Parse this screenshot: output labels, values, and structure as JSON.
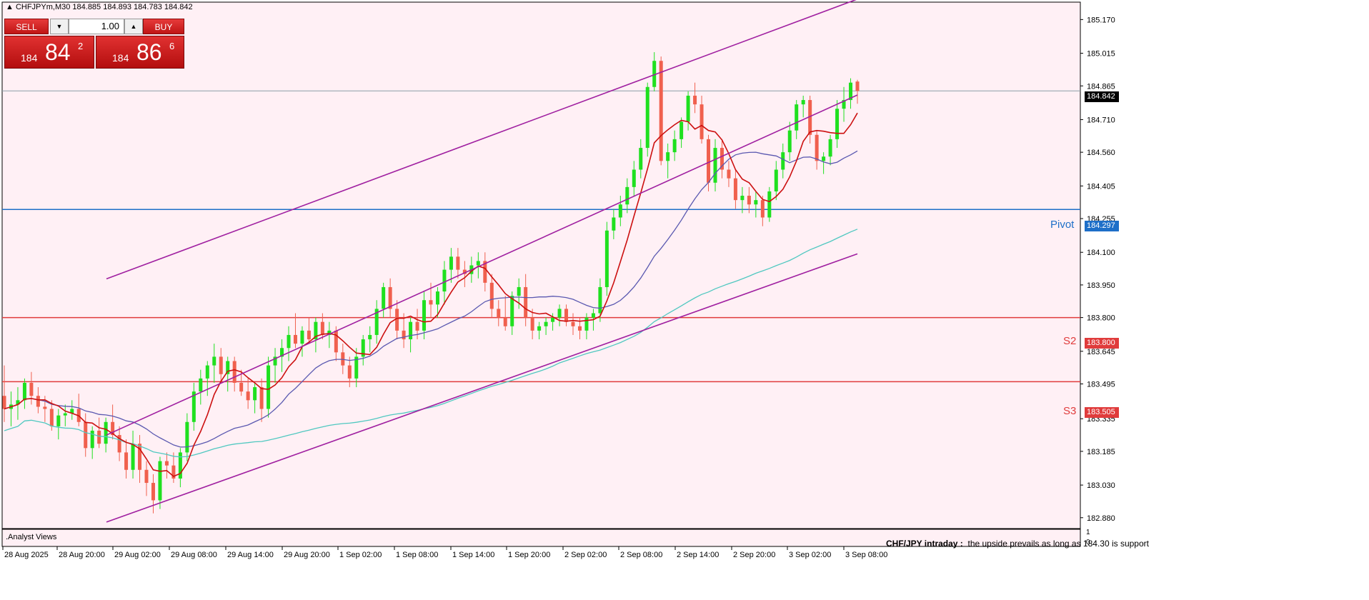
{
  "window": {
    "symbol_line": "CHFJPYm,M30  184.885 184.893 184.783 184.842"
  },
  "trade_panel": {
    "sell_label": "SELL",
    "buy_label": "BUY",
    "lot_value": "1.00",
    "sell_price_prefix": "184",
    "sell_price_big": "84",
    "sell_price_sup": "2",
    "buy_price_prefix": "184",
    "buy_price_big": "86",
    "buy_price_sup": "6"
  },
  "levels": {
    "pivot": {
      "label": "Pivot",
      "value_tag": "184.297",
      "color": "#1e6fc8"
    },
    "s2": {
      "label": "S2",
      "value_tag": "183.800",
      "color": "#e03c3c"
    },
    "s3": {
      "label": "S3",
      "value_tag": "183.505",
      "color": "#e03c3c"
    },
    "current": {
      "value_tag": "184.842"
    }
  },
  "subwindow": {
    "title": ".Analyst Views",
    "headline": "CHF/JPY intraday :",
    "text": "the upside prevails as long as 184.30 is support",
    "tick_top": "1",
    "tick_bottom": "0"
  },
  "chart_data": {
    "type": "candlestick",
    "symbol": "CHFJPYm",
    "timeframe": "M30",
    "y_ticks": [
      "185.170",
      "185.015",
      "184.865",
      "184.710",
      "184.560",
      "184.405",
      "184.255",
      "184.100",
      "183.950",
      "183.800",
      "183.645",
      "183.495",
      "183.335",
      "183.185",
      "183.030",
      "182.880"
    ],
    "x_ticks": [
      "28 Aug 2025",
      "28 Aug 20:00",
      "29 Aug 02:00",
      "29 Aug 08:00",
      "29 Aug 14:00",
      "29 Aug 20:00",
      "1 Sep 02:00",
      "1 Sep 08:00",
      "1 Sep 14:00",
      "1 Sep 20:00",
      "2 Sep 02:00",
      "2 Sep 08:00",
      "2 Sep 14:00",
      "2 Sep 20:00",
      "3 Sep 02:00",
      "3 Sep 08:00"
    ],
    "ylim": [
      182.83,
      185.25
    ],
    "ohlc": {
      "open": 184.885,
      "high": 184.893,
      "low": 184.783,
      "close": 184.842
    },
    "bull_color": "#1fe01f",
    "bear_color": "#f0604e",
    "horizontal_levels": [
      184.842,
      184.297,
      183.8,
      183.505
    ],
    "channel_lines": [
      {
        "name": "upper",
        "from": [
          0.3,
          183.978
        ],
        "to": [
          0.98,
          185.264
        ],
        "color": "#a020a0"
      },
      {
        "name": "middle",
        "from": [
          0.3,
          183.26
        ],
        "to": [
          0.98,
          184.823
        ],
        "color": "#a020a0"
      },
      {
        "name": "lower",
        "from": [
          0.3,
          182.86
        ],
        "to": [
          0.98,
          184.093
        ],
        "color": "#a020a0"
      }
    ],
    "moving_averages": [
      {
        "name": "MA fast",
        "color": "#cc1010"
      },
      {
        "name": "MA mid",
        "color": "#5a58b0"
      },
      {
        "name": "MA slow",
        "color": "#4fc8c0"
      }
    ],
    "candles": [
      [
        183.44,
        183.58,
        183.32,
        183.38
      ],
      [
        183.38,
        183.46,
        183.3,
        183.4
      ],
      [
        183.4,
        183.48,
        183.33,
        183.42
      ],
      [
        183.42,
        183.52,
        183.38,
        183.5
      ],
      [
        183.5,
        183.55,
        183.4,
        183.44
      ],
      [
        183.44,
        183.48,
        183.36,
        183.39
      ],
      [
        183.39,
        183.44,
        183.32,
        183.38
      ],
      [
        183.38,
        183.42,
        183.28,
        183.3
      ],
      [
        183.3,
        183.38,
        183.24,
        183.35
      ],
      [
        183.35,
        183.4,
        183.3,
        183.36
      ],
      [
        183.36,
        183.42,
        183.33,
        183.38
      ],
      [
        183.38,
        183.45,
        183.3,
        183.32
      ],
      [
        183.32,
        183.36,
        183.16,
        183.2
      ],
      [
        183.2,
        183.3,
        183.15,
        183.28
      ],
      [
        183.28,
        183.34,
        183.2,
        183.22
      ],
      [
        183.22,
        183.34,
        183.18,
        183.32
      ],
      [
        183.32,
        183.4,
        183.24,
        183.26
      ],
      [
        183.26,
        183.3,
        183.14,
        183.18
      ],
      [
        183.18,
        183.24,
        183.06,
        183.1
      ],
      [
        183.1,
        183.28,
        183.06,
        183.22
      ],
      [
        183.22,
        183.26,
        183.04,
        183.1
      ],
      [
        183.1,
        183.14,
        182.98,
        183.04
      ],
      [
        183.04,
        183.08,
        182.9,
        182.96
      ],
      [
        182.96,
        183.16,
        182.92,
        183.14
      ],
      [
        183.14,
        183.18,
        183.06,
        183.12
      ],
      [
        183.12,
        183.18,
        183.04,
        183.06
      ],
      [
        183.06,
        183.2,
        183.02,
        183.18
      ],
      [
        183.18,
        183.36,
        183.14,
        183.32
      ],
      [
        183.32,
        183.5,
        183.28,
        183.46
      ],
      [
        183.46,
        183.56,
        183.4,
        183.52
      ],
      [
        183.52,
        183.6,
        183.44,
        183.58
      ],
      [
        183.58,
        183.68,
        183.5,
        183.62
      ],
      [
        183.62,
        183.66,
        183.5,
        183.54
      ],
      [
        183.54,
        183.62,
        183.46,
        183.6
      ],
      [
        183.6,
        183.62,
        183.46,
        183.5
      ],
      [
        183.5,
        183.56,
        183.44,
        183.46
      ],
      [
        183.46,
        183.52,
        183.38,
        183.42
      ],
      [
        183.42,
        183.5,
        183.36,
        183.48
      ],
      [
        183.48,
        183.52,
        183.32,
        183.38
      ],
      [
        183.38,
        183.62,
        183.34,
        183.58
      ],
      [
        183.58,
        183.66,
        183.5,
        183.62
      ],
      [
        183.62,
        183.7,
        183.55,
        183.66
      ],
      [
        183.66,
        183.76,
        183.6,
        183.72
      ],
      [
        183.72,
        183.82,
        183.66,
        183.68
      ],
      [
        183.68,
        183.76,
        183.62,
        183.74
      ],
      [
        183.74,
        183.8,
        183.68,
        183.7
      ],
      [
        183.7,
        183.8,
        183.64,
        183.78
      ],
      [
        183.78,
        183.82,
        183.7,
        183.72
      ],
      [
        183.72,
        183.78,
        183.66,
        183.74
      ],
      [
        183.74,
        183.76,
        183.6,
        183.64
      ],
      [
        183.64,
        183.68,
        183.54,
        183.58
      ],
      [
        183.58,
        183.62,
        183.48,
        183.52
      ],
      [
        183.52,
        183.66,
        183.48,
        183.62
      ],
      [
        183.62,
        183.72,
        183.58,
        183.7
      ],
      [
        183.7,
        183.76,
        183.64,
        183.72
      ],
      [
        183.72,
        183.88,
        183.68,
        183.84
      ],
      [
        183.84,
        183.96,
        183.8,
        183.94
      ],
      [
        183.94,
        183.98,
        183.8,
        183.84
      ],
      [
        183.84,
        183.88,
        183.7,
        183.74
      ],
      [
        183.74,
        183.82,
        183.66,
        183.7
      ],
      [
        183.7,
        183.8,
        183.64,
        183.78
      ],
      [
        183.78,
        183.84,
        183.7,
        183.74
      ],
      [
        183.74,
        183.92,
        183.7,
        183.88
      ],
      [
        183.88,
        183.96,
        183.8,
        183.86
      ],
      [
        183.86,
        183.94,
        183.8,
        183.92
      ],
      [
        183.92,
        184.06,
        183.86,
        184.02
      ],
      [
        184.02,
        184.12,
        183.96,
        184.08
      ],
      [
        184.08,
        184.12,
        183.98,
        184.02
      ],
      [
        184.02,
        184.06,
        183.94,
        184.0
      ],
      [
        184.0,
        184.08,
        183.96,
        184.04
      ],
      [
        184.04,
        184.1,
        183.98,
        184.06
      ],
      [
        184.06,
        184.1,
        183.92,
        183.96
      ],
      [
        183.96,
        184.0,
        183.8,
        183.84
      ],
      [
        183.84,
        183.88,
        183.76,
        183.8
      ],
      [
        183.8,
        183.9,
        183.74,
        183.76
      ],
      [
        183.76,
        183.92,
        183.72,
        183.9
      ],
      [
        183.9,
        183.98,
        183.84,
        183.94
      ],
      [
        183.94,
        184.0,
        183.76,
        183.8
      ],
      [
        183.8,
        183.84,
        183.7,
        183.74
      ],
      [
        183.74,
        183.78,
        183.7,
        183.76
      ],
      [
        183.76,
        183.8,
        183.72,
        183.78
      ],
      [
        183.78,
        183.82,
        183.74,
        183.8
      ],
      [
        183.8,
        183.86,
        183.76,
        183.84
      ],
      [
        183.84,
        183.86,
        183.76,
        183.78
      ],
      [
        183.78,
        183.82,
        183.72,
        183.76
      ],
      [
        183.76,
        183.8,
        183.7,
        183.74
      ],
      [
        183.74,
        183.82,
        183.7,
        183.8
      ],
      [
        183.8,
        183.84,
        183.74,
        183.82
      ],
      [
        183.82,
        183.98,
        183.78,
        183.94
      ],
      [
        183.94,
        184.24,
        183.9,
        184.2
      ],
      [
        184.2,
        184.3,
        184.16,
        184.26
      ],
      [
        184.26,
        184.36,
        184.22,
        184.32
      ],
      [
        184.32,
        184.44,
        184.28,
        184.4
      ],
      [
        184.4,
        184.52,
        184.36,
        184.48
      ],
      [
        184.48,
        184.62,
        184.44,
        184.58
      ],
      [
        184.58,
        184.88,
        184.54,
        184.86
      ],
      [
        184.86,
        185.02,
        184.84,
        184.98
      ],
      [
        184.98,
        185.0,
        184.5,
        184.52
      ],
      [
        184.52,
        184.6,
        184.44,
        184.56
      ],
      [
        184.56,
        184.66,
        184.52,
        184.62
      ],
      [
        184.62,
        184.72,
        184.58,
        184.7
      ],
      [
        184.7,
        184.84,
        184.66,
        184.82
      ],
      [
        184.82,
        184.88,
        184.74,
        184.78
      ],
      [
        184.78,
        184.82,
        184.6,
        184.62
      ],
      [
        184.62,
        184.64,
        184.38,
        184.42
      ],
      [
        184.42,
        184.62,
        184.38,
        184.58
      ],
      [
        184.58,
        184.62,
        184.44,
        184.48
      ],
      [
        184.48,
        184.52,
        184.4,
        184.44
      ],
      [
        184.44,
        184.48,
        184.3,
        184.34
      ],
      [
        184.34,
        184.4,
        184.28,
        184.36
      ],
      [
        184.36,
        184.4,
        184.28,
        184.32
      ],
      [
        184.32,
        184.38,
        184.26,
        184.34
      ],
      [
        184.34,
        184.36,
        184.22,
        184.26
      ],
      [
        184.26,
        184.4,
        184.24,
        184.38
      ],
      [
        184.38,
        184.52,
        184.34,
        184.48
      ],
      [
        184.48,
        184.6,
        184.44,
        184.56
      ],
      [
        184.56,
        184.7,
        184.52,
        184.66
      ],
      [
        184.66,
        184.8,
        184.62,
        184.78
      ],
      [
        184.78,
        184.82,
        184.72,
        184.8
      ],
      [
        184.8,
        184.82,
        184.6,
        184.64
      ],
      [
        184.64,
        184.66,
        184.48,
        184.52
      ],
      [
        184.52,
        184.56,
        184.46,
        184.54
      ],
      [
        184.54,
        184.64,
        184.5,
        184.62
      ],
      [
        184.62,
        184.8,
        184.58,
        184.76
      ],
      [
        184.76,
        184.86,
        184.7,
        184.8
      ],
      [
        184.8,
        184.9,
        184.76,
        184.88
      ],
      [
        184.885,
        184.893,
        184.783,
        184.842
      ]
    ]
  }
}
